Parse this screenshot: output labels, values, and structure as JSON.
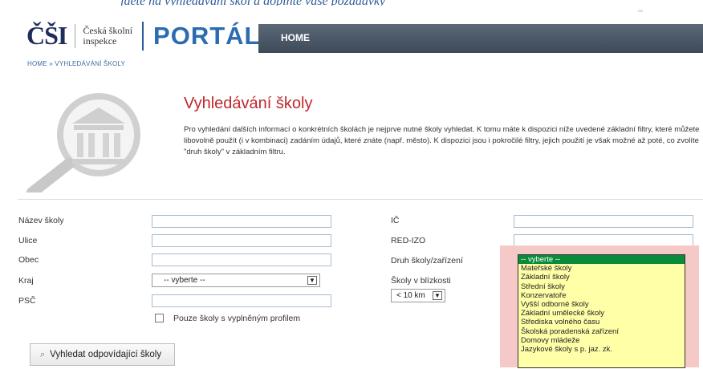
{
  "top_strip_text": "jděte na vyhledávání škol a doplňte vaše požadavky",
  "header": {
    "logo_main": "ČŠI",
    "logo_sub_line1": "Česká školní",
    "logo_sub_line2": "inspekce",
    "portal": "PORTÁL",
    "nav_home": "HOME"
  },
  "breadcrumb": "HOME  »  VYHLEDÁVÁNÍ ŠKOLY",
  "page": {
    "title": "Vyhledávání školy",
    "intro": "Pro vyhledání dalších informací o konkrétních školách je nejprve nutné školy vyhledat. K tomu máte k dispozici níže uvedené základní filtry, které můžete libovolně použít (i v kombinaci) zadáním údajů, které znáte (např. město). K dispozici jsou i pokročilé filtry, jejich použití je však možné až poté, co zvolíte \"druh školy\" v základním filtru."
  },
  "form": {
    "nazev_label": "Název školy",
    "nazev_value": "",
    "ulice_label": "Ulice",
    "ulice_value": "",
    "obec_label": "Obec",
    "obec_value": "",
    "kraj_label": "Kraj",
    "kraj_value": "-- vyberte --",
    "psc_label": "PSČ",
    "psc_value": "",
    "profile_checkbox_label": "Pouze školy s vyplněným profilem",
    "ic_label": "IČ",
    "ic_value": "",
    "redizo_label": "RED-IZO",
    "redizo_value": "",
    "druh_label": "Druh školy/zařízení",
    "vicinity_label": "Školy v blízkosti",
    "vicinity_value": "< 10 km",
    "search_button": "Vyhledat odpovídající školy"
  },
  "druh_options": [
    "-- vyberte --",
    "Mateřské školy",
    "Základní školy",
    "Střední školy",
    "Konzervatoře",
    "Vyšší odborné školy",
    "Základní umělecké školy",
    "Střediska volného času",
    "Školská poradenská zařízení",
    "Domovy mládeže",
    "Jazykové školy s p. jaz. zk."
  ],
  "colors": {
    "accent_red": "#c0272d",
    "brand_blue": "#2b6cb0",
    "nav_dark": "#4a5666",
    "dropdown_bg": "#ffffa8",
    "dropdown_selected": "#0a8b3a",
    "highlight_pink": "#f6c9c9"
  },
  "icons": {
    "hero": "magnifier-building-icon",
    "search": "search-icon",
    "dropdown_arrow": "chevron-down-icon"
  }
}
